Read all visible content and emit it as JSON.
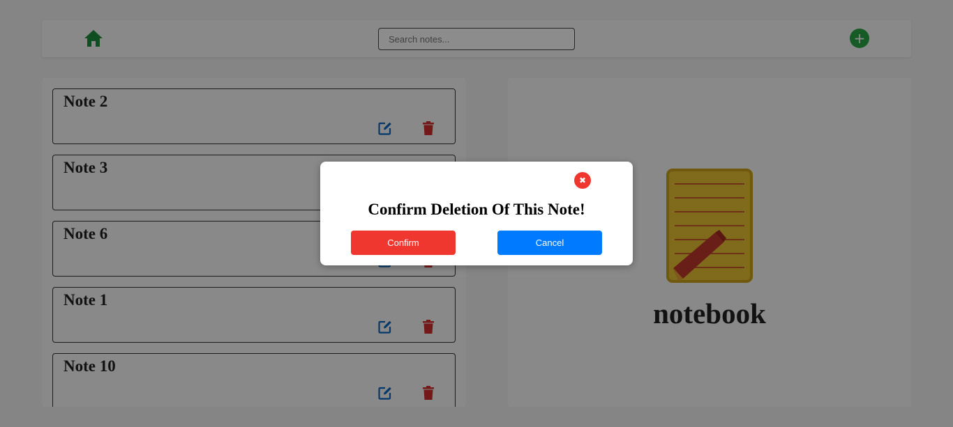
{
  "navbar": {
    "home_icon": "home-icon",
    "search_placeholder": "Search notes...",
    "search_value": "",
    "add_label": "+"
  },
  "notes": [
    {
      "title": "Note 2"
    },
    {
      "title": "Note 3"
    },
    {
      "title": "Note 6"
    },
    {
      "title": "Note 1"
    },
    {
      "title": "Note 10"
    }
  ],
  "preview": {
    "brand": "notebook"
  },
  "modal": {
    "close_label": "✖",
    "title": "Confirm Deletion Of This Note!",
    "confirm_label": "Confirm",
    "cancel_label": "Cancel"
  },
  "colors": {
    "home_icon": "#1e8e3e",
    "add_button": "#28a745",
    "edit_icon": "#0a66c2",
    "delete_icon": "#d32f2f",
    "confirm_button": "#f0372f",
    "cancel_button": "#007bff"
  }
}
